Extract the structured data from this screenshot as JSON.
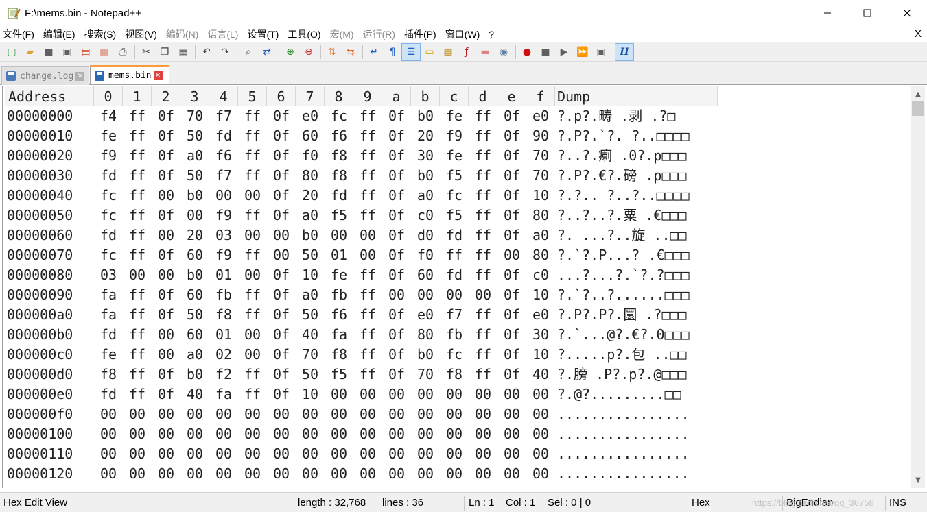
{
  "window": {
    "title": "F:\\mems.bin - Notepad++",
    "minimize_label": "—",
    "maximize_label": "☐",
    "close_label": "✕"
  },
  "menu": [
    {
      "label": "文件(F)",
      "enabled": true
    },
    {
      "label": "编辑(E)",
      "enabled": true
    },
    {
      "label": "搜索(S)",
      "enabled": true
    },
    {
      "label": "视图(V)",
      "enabled": true
    },
    {
      "label": "编码(N)",
      "enabled": false
    },
    {
      "label": "语言(L)",
      "enabled": false
    },
    {
      "label": "设置(T)",
      "enabled": true
    },
    {
      "label": "工具(O)",
      "enabled": true
    },
    {
      "label": "宏(M)",
      "enabled": false
    },
    {
      "label": "运行(R)",
      "enabled": false
    },
    {
      "label": "插件(P)",
      "enabled": true
    },
    {
      "label": "窗口(W)",
      "enabled": true
    },
    {
      "label": "?",
      "enabled": true
    }
  ],
  "menu_close_label": "X",
  "toolbar": [
    {
      "icon": "new-file-icon",
      "glyph": "▢",
      "color": "#3a9a3a"
    },
    {
      "icon": "open-file-icon",
      "glyph": "▰",
      "color": "#e0a030"
    },
    {
      "icon": "save-icon",
      "glyph": "■",
      "color": "#606060"
    },
    {
      "icon": "save-all-icon",
      "glyph": "▣",
      "color": "#606060"
    },
    {
      "icon": "close-icon",
      "glyph": "▤",
      "color": "#d04020"
    },
    {
      "icon": "close-all-icon",
      "glyph": "▥",
      "color": "#d04020"
    },
    {
      "icon": "print-icon",
      "glyph": "⎙",
      "color": "#505050"
    },
    {
      "sep": true
    },
    {
      "icon": "cut-icon",
      "glyph": "✂",
      "color": "#404040"
    },
    {
      "icon": "copy-icon",
      "glyph": "❐",
      "color": "#404040"
    },
    {
      "icon": "paste-icon",
      "glyph": "▦",
      "color": "#606060"
    },
    {
      "sep": true
    },
    {
      "icon": "undo-icon",
      "glyph": "↶",
      "color": "#404040"
    },
    {
      "icon": "redo-icon",
      "glyph": "↷",
      "color": "#404040"
    },
    {
      "sep": true
    },
    {
      "icon": "find-icon",
      "glyph": "⌕",
      "color": "#303030"
    },
    {
      "icon": "replace-icon",
      "glyph": "⇄",
      "color": "#2060c0"
    },
    {
      "sep": true
    },
    {
      "icon": "zoom-in-icon",
      "glyph": "⊕",
      "color": "#2a8a2a"
    },
    {
      "icon": "zoom-out-icon",
      "glyph": "⊖",
      "color": "#c03030"
    },
    {
      "sep": true
    },
    {
      "icon": "sync-vertical-icon",
      "glyph": "⇅",
      "color": "#e07020"
    },
    {
      "icon": "sync-horizontal-icon",
      "glyph": "⇆",
      "color": "#e07020"
    },
    {
      "sep": true
    },
    {
      "icon": "word-wrap-icon",
      "glyph": "↵",
      "color": "#2060c0"
    },
    {
      "icon": "show-all-characters-icon",
      "glyph": "¶",
      "color": "#2060c0"
    },
    {
      "icon": "indent-guide-icon",
      "glyph": "☰",
      "color": "#2060c0",
      "active": true
    },
    {
      "icon": "user-language-icon",
      "glyph": "▭",
      "color": "#d0a000"
    },
    {
      "icon": "document-map-icon",
      "glyph": "▩",
      "color": "#c09020"
    },
    {
      "icon": "function-list-icon",
      "glyph": "ƒ",
      "color": "#c02020"
    },
    {
      "icon": "folder-workspace-icon",
      "glyph": "▬",
      "color": "#e08080"
    },
    {
      "icon": "monitoring-icon",
      "glyph": "◉",
      "color": "#6080a0"
    },
    {
      "sep": true
    },
    {
      "icon": "macro-record-icon",
      "glyph": "●",
      "color": "#d01010"
    },
    {
      "icon": "macro-stop-icon",
      "glyph": "■",
      "color": "#606060"
    },
    {
      "icon": "macro-play-icon",
      "glyph": "▶",
      "color": "#606060"
    },
    {
      "icon": "macro-run-multiple-icon",
      "glyph": "⏩",
      "color": "#2060c0"
    },
    {
      "icon": "macro-save-icon",
      "glyph": "▣",
      "color": "#606060"
    },
    {
      "sep": true
    },
    {
      "icon": "hex-editor-icon",
      "glyph": "H",
      "color": "#2050a0",
      "active": true
    }
  ],
  "tabs": [
    {
      "label": "change.log",
      "active": false
    },
    {
      "label": "mems.bin",
      "active": true
    }
  ],
  "tab_close_glyph": "✕",
  "hex": {
    "header_address": "Address",
    "columns": [
      "0",
      "1",
      "2",
      "3",
      "4",
      "5",
      "6",
      "7",
      "8",
      "9",
      "a",
      "b",
      "c",
      "d",
      "e",
      "f"
    ],
    "header_dump": "Dump",
    "rows": [
      {
        "addr": "00000000",
        "bytes": [
          "f4",
          "ff",
          "0f",
          "70",
          "f7",
          "ff",
          "0f",
          "e0",
          "fc",
          "ff",
          "0f",
          "b0",
          "fe",
          "ff",
          "0f",
          "e0"
        ],
        "dump": "?.p?.畴  .剥  .?□"
      },
      {
        "addr": "00000010",
        "bytes": [
          "fe",
          "ff",
          "0f",
          "50",
          "fd",
          "ff",
          "0f",
          "60",
          "f6",
          "ff",
          "0f",
          "20",
          "f9",
          "ff",
          "0f",
          "90"
        ],
        "dump": "?.P?.`?. ?..□□□□"
      },
      {
        "addr": "00000020",
        "bytes": [
          "f9",
          "ff",
          "0f",
          "a0",
          "f6",
          "ff",
          "0f",
          "f0",
          "f8",
          "ff",
          "0f",
          "30",
          "fe",
          "ff",
          "0f",
          "70"
        ],
        "dump": "?..?.瘌  .0?.p□□□"
      },
      {
        "addr": "00000030",
        "bytes": [
          "fd",
          "ff",
          "0f",
          "50",
          "f7",
          "ff",
          "0f",
          "80",
          "f8",
          "ff",
          "0f",
          "b0",
          "f5",
          "ff",
          "0f",
          "70"
        ],
        "dump": "?.P?.€?.磅  .p□□□"
      },
      {
        "addr": "00000040",
        "bytes": [
          "fc",
          "ff",
          "00",
          "b0",
          "00",
          "00",
          "0f",
          "20",
          "fd",
          "ff",
          "0f",
          "a0",
          "fc",
          "ff",
          "0f",
          "10"
        ],
        "dump": "?.?.. ?..?..□□□□"
      },
      {
        "addr": "00000050",
        "bytes": [
          "fc",
          "ff",
          "0f",
          "00",
          "f9",
          "ff",
          "0f",
          "a0",
          "f5",
          "ff",
          "0f",
          "c0",
          "f5",
          "ff",
          "0f",
          "80"
        ],
        "dump": "?..?..?.粟  .€□□□"
      },
      {
        "addr": "00000060",
        "bytes": [
          "fd",
          "ff",
          "00",
          "20",
          "03",
          "00",
          "00",
          "b0",
          "00",
          "00",
          "0f",
          "d0",
          "fd",
          "ff",
          "0f",
          "a0"
        ],
        "dump": "?. ...?..旋  ..□□"
      },
      {
        "addr": "00000070",
        "bytes": [
          "fc",
          "ff",
          "0f",
          "60",
          "f9",
          "ff",
          "00",
          "50",
          "01",
          "00",
          "0f",
          "f0",
          "ff",
          "ff",
          "00",
          "80"
        ],
        "dump": "?.`?.P...?  .€□□□"
      },
      {
        "addr": "00000080",
        "bytes": [
          "03",
          "00",
          "00",
          "b0",
          "01",
          "00",
          "0f",
          "10",
          "fe",
          "ff",
          "0f",
          "60",
          "fd",
          "ff",
          "0f",
          "c0"
        ],
        "dump": "...?...?.`?.?□□□"
      },
      {
        "addr": "00000090",
        "bytes": [
          "fa",
          "ff",
          "0f",
          "60",
          "fb",
          "ff",
          "0f",
          "a0",
          "fb",
          "ff",
          "00",
          "00",
          "00",
          "00",
          "0f",
          "10"
        ],
        "dump": "?.`?..?......□□□"
      },
      {
        "addr": "000000a0",
        "bytes": [
          "fa",
          "ff",
          "0f",
          "50",
          "f8",
          "ff",
          "0f",
          "50",
          "f6",
          "ff",
          "0f",
          "e0",
          "f7",
          "ff",
          "0f",
          "e0"
        ],
        "dump": "?.P?.P?.圜  .?□□□"
      },
      {
        "addr": "000000b0",
        "bytes": [
          "fd",
          "ff",
          "00",
          "60",
          "01",
          "00",
          "0f",
          "40",
          "fa",
          "ff",
          "0f",
          "80",
          "fb",
          "ff",
          "0f",
          "30"
        ],
        "dump": "?.`...@?.€?.0□□□"
      },
      {
        "addr": "000000c0",
        "bytes": [
          "fe",
          "ff",
          "00",
          "a0",
          "02",
          "00",
          "0f",
          "70",
          "f8",
          "ff",
          "0f",
          "b0",
          "fc",
          "ff",
          "0f",
          "10"
        ],
        "dump": "?.....p?.包  ..□□"
      },
      {
        "addr": "000000d0",
        "bytes": [
          "f8",
          "ff",
          "0f",
          "b0",
          "f2",
          "ff",
          "0f",
          "50",
          "f5",
          "ff",
          "0f",
          "70",
          "f8",
          "ff",
          "0f",
          "40"
        ],
        "dump": "?.膀  .P?.p?.@□□□"
      },
      {
        "addr": "000000e0",
        "bytes": [
          "fd",
          "ff",
          "0f",
          "40",
          "fa",
          "ff",
          "0f",
          "10",
          "00",
          "00",
          "00",
          "00",
          "00",
          "00",
          "00",
          "00"
        ],
        "dump": "?.@?.........□□"
      },
      {
        "addr": "000000f0",
        "bytes": [
          "00",
          "00",
          "00",
          "00",
          "00",
          "00",
          "00",
          "00",
          "00",
          "00",
          "00",
          "00",
          "00",
          "00",
          "00",
          "00"
        ],
        "dump": "................"
      },
      {
        "addr": "00000100",
        "bytes": [
          "00",
          "00",
          "00",
          "00",
          "00",
          "00",
          "00",
          "00",
          "00",
          "00",
          "00",
          "00",
          "00",
          "00",
          "00",
          "00"
        ],
        "dump": "................"
      },
      {
        "addr": "00000110",
        "bytes": [
          "00",
          "00",
          "00",
          "00",
          "00",
          "00",
          "00",
          "00",
          "00",
          "00",
          "00",
          "00",
          "00",
          "00",
          "00",
          "00"
        ],
        "dump": "................"
      },
      {
        "addr": "00000120",
        "bytes": [
          "00",
          "00",
          "00",
          "00",
          "00",
          "00",
          "00",
          "00",
          "00",
          "00",
          "00",
          "00",
          "00",
          "00",
          "00",
          "00"
        ],
        "dump": "................"
      }
    ]
  },
  "scrollbar": {
    "up_glyph": "▲",
    "down_glyph": "▼"
  },
  "status": {
    "mode": "Hex Edit View",
    "length": "length : 32,768",
    "lines": "lines : 36",
    "ln": "Ln : 1",
    "col": "Col : 1",
    "sel": "Sel : 0 | 0",
    "view": "Hex",
    "endian": "BigEndian",
    "ins": "INS",
    "watermark": "https://blog.csdn.net/qq_36758"
  },
  "colors": {
    "tab_accent": "#fa9c3c",
    "tab_disk_active": "#2a6ab0",
    "tab_disk_inactive": "#4a7ab8",
    "tab_close_active": "#e04040",
    "tab_close_inactive": "#b0b0b0"
  }
}
